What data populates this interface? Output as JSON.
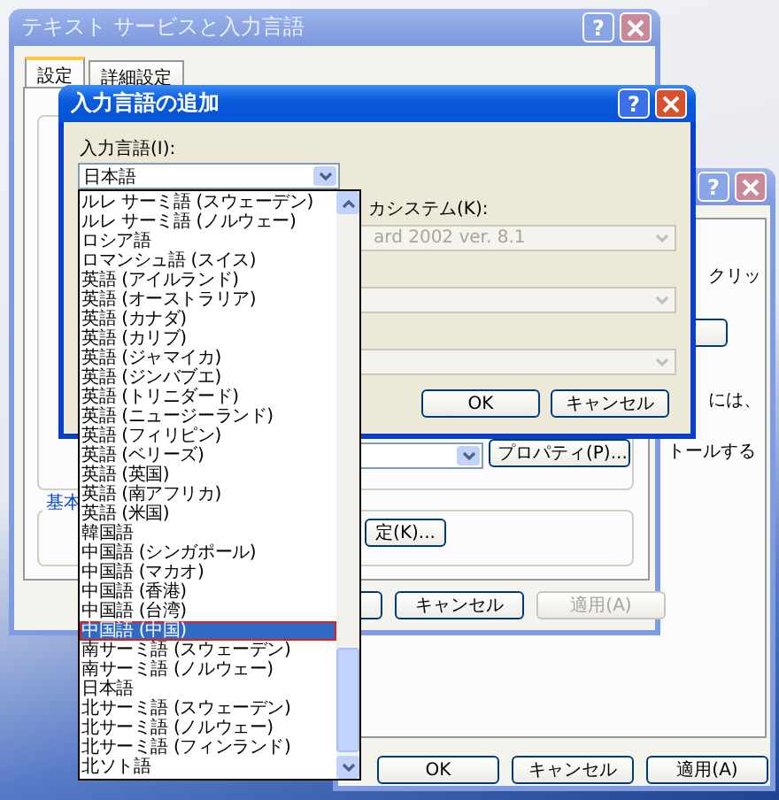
{
  "main_window": {
    "title": "テキスト サービスと入力言語",
    "help": "?",
    "tabs": [
      {
        "label": "設定",
        "selected": true
      },
      {
        "label": "詳細設定",
        "selected": false
      }
    ],
    "group_label": "基本",
    "properties_button": "プロパティ(P)...",
    "key_settings_button": "定(K)...",
    "buttons": [
      {
        "label": "キャンセル",
        "disabled": false
      },
      {
        "label": "適用(A)",
        "disabled": true
      }
    ]
  },
  "right_window": {
    "help": "?",
    "texts": [
      "クリッ",
      "には、",
      "トールする"
    ],
    "buttons": [
      {
        "label": "OK",
        "disabled": false
      },
      {
        "label": "キャンセル",
        "disabled": false
      },
      {
        "label": "適用(A)",
        "disabled": false
      }
    ]
  },
  "add_dialog": {
    "title": "入力言語の追加",
    "help": "?",
    "language_label": "入力言語(I):",
    "language_value": "日本語",
    "keyboard_label": "カシステム(K):",
    "keyboard_value": "ard 2002 ver. 8.1",
    "buttons": [
      {
        "label": "OK",
        "disabled": false
      },
      {
        "label": "キャンセル",
        "disabled": false
      }
    ]
  },
  "dropdown_items": [
    {
      "label": "ルレ サーミ語 (スウェーデン)",
      "selected": false
    },
    {
      "label": "ルレ サーミ語 (ノルウェー)",
      "selected": false
    },
    {
      "label": "ロシア語",
      "selected": false
    },
    {
      "label": "ロマンシュ語 (スイス)",
      "selected": false
    },
    {
      "label": "英語 (アイルランド)",
      "selected": false
    },
    {
      "label": "英語 (オーストラリア)",
      "selected": false
    },
    {
      "label": "英語 (カナダ)",
      "selected": false
    },
    {
      "label": "英語 (カリブ)",
      "selected": false
    },
    {
      "label": "英語 (ジャマイカ)",
      "selected": false
    },
    {
      "label": "英語 (ジンバブエ)",
      "selected": false
    },
    {
      "label": "英語 (トリニダード)",
      "selected": false
    },
    {
      "label": "英語 (ニュージーランド)",
      "selected": false
    },
    {
      "label": "英語 (フィリピン)",
      "selected": false
    },
    {
      "label": "英語 (ベリーズ)",
      "selected": false
    },
    {
      "label": "英語 (英国)",
      "selected": false
    },
    {
      "label": "英語 (南アフリカ)",
      "selected": false
    },
    {
      "label": "英語 (米国)",
      "selected": false
    },
    {
      "label": "韓国語",
      "selected": false
    },
    {
      "label": "中国語 (シンガポール)",
      "selected": false
    },
    {
      "label": "中国語 (マカオ)",
      "selected": false
    },
    {
      "label": "中国語 (香港)",
      "selected": false
    },
    {
      "label": "中国語 (台湾)",
      "selected": false
    },
    {
      "label": "中国語 (中国)",
      "selected": true
    },
    {
      "label": "南サーミ語 (スウェーデン)",
      "selected": false
    },
    {
      "label": "南サーミ語 (ノルウェー)",
      "selected": false
    },
    {
      "label": "日本語",
      "selected": false
    },
    {
      "label": "北サーミ語 (スウェーデン)",
      "selected": false
    },
    {
      "label": "北サーミ語 (ノルウェー)",
      "selected": false
    },
    {
      "label": "北サーミ語 (フィンランド)",
      "selected": false
    },
    {
      "label": "北ソト語",
      "selected": false
    }
  ]
}
